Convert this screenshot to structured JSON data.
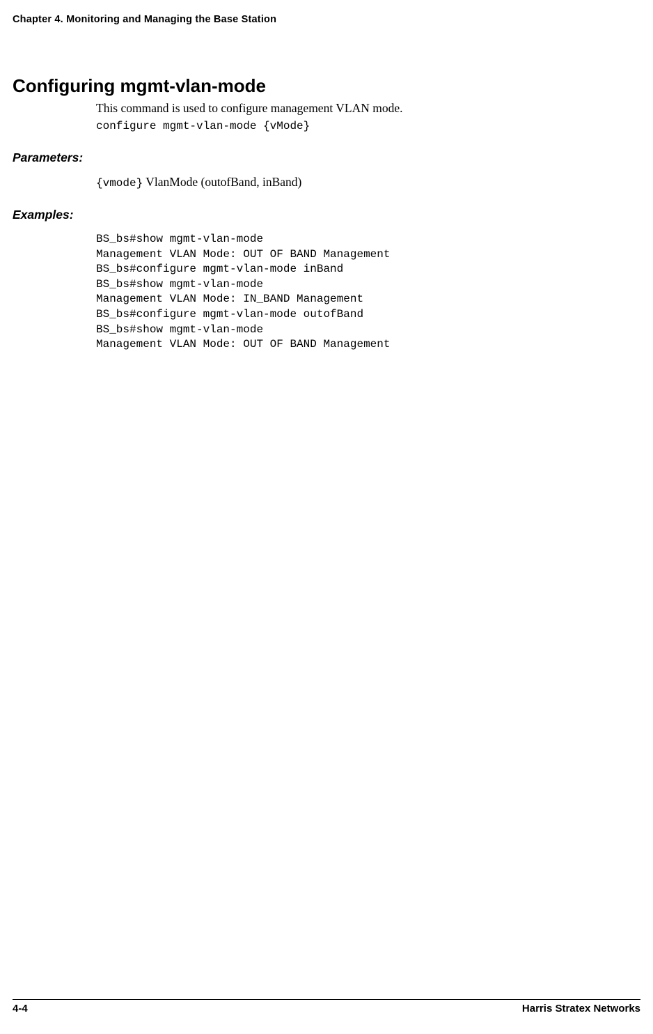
{
  "header": {
    "chapter_label": "Chapter 4.  Monitoring and Managing the Base Station"
  },
  "main": {
    "title": "Configuring mgmt-vlan-mode",
    "intro": "This command is used to configure management VLAN mode.",
    "command": "configure mgmt-vlan-mode {vMode}"
  },
  "parameters": {
    "heading": "Parameters:",
    "param_code": "{vmode}",
    "param_desc": " VlanMode (outofBand, inBand)"
  },
  "examples": {
    "heading": "Examples:",
    "block": "BS_bs#show mgmt-vlan-mode\nManagement VLAN Mode: OUT OF BAND Management\nBS_bs#configure mgmt-vlan-mode inBand\nBS_bs#show mgmt-vlan-mode\nManagement VLAN Mode: IN_BAND Management\nBS_bs#configure mgmt-vlan-mode outofBand\nBS_bs#show mgmt-vlan-mode\nManagement VLAN Mode: OUT OF BAND Management"
  },
  "footer": {
    "page_number": "4-4",
    "company": "Harris Stratex Networks"
  }
}
